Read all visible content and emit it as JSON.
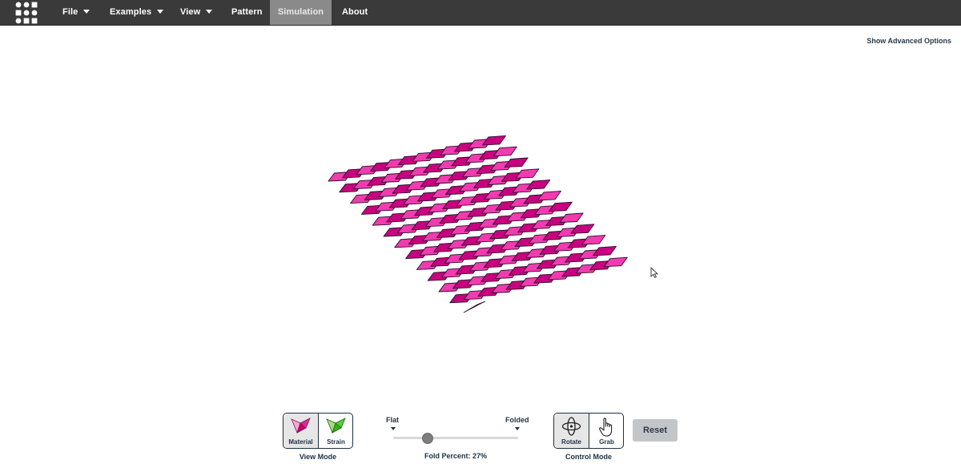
{
  "navbar": {
    "items": [
      {
        "label": "File",
        "dropdown": true
      },
      {
        "label": "Examples",
        "dropdown": true
      },
      {
        "label": "View",
        "dropdown": true
      },
      {
        "label": "Pattern",
        "dropdown": false
      },
      {
        "label": "Simulation",
        "dropdown": false,
        "active": true
      },
      {
        "label": "About",
        "dropdown": false
      }
    ]
  },
  "advanced_options_label": "Show Advanced Options",
  "view_mode": {
    "caption": "View Mode",
    "buttons": [
      {
        "label": "Material",
        "icon": "material-icon",
        "selected": true
      },
      {
        "label": "Strain",
        "icon": "strain-icon",
        "selected": false
      }
    ]
  },
  "fold_slider": {
    "min_label": "Flat",
    "max_label": "Folded",
    "caption": "Fold Percent: 27%",
    "percent": 27
  },
  "control_mode": {
    "caption": "Control Mode",
    "buttons": [
      {
        "label": "Rotate",
        "icon": "rotate-icon",
        "selected": true
      },
      {
        "label": "Grab",
        "icon": "hand-icon",
        "selected": false
      }
    ]
  },
  "reset_label": "Reset",
  "colors": {
    "nav_bg": "#3a3a3a",
    "pattern_light": "#f23bb0",
    "pattern_dark": "#c9007f",
    "pattern_edge": "#2a0f2a",
    "accent_text": "#1f3142"
  }
}
